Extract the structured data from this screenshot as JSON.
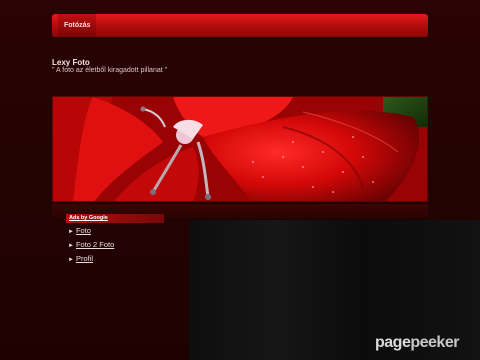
{
  "nav": {
    "tabs": [
      {
        "label": "Fotózás"
      }
    ]
  },
  "site": {
    "title": "Lexy Foto",
    "slogan": "\" A foto az életből kiragadott pillanat \""
  },
  "sidebar": {
    "ads_header": "Ads by Google",
    "links": [
      {
        "label": "Foto"
      },
      {
        "label": "Foto 2 Foto"
      },
      {
        "label": "Profil"
      }
    ]
  },
  "watermark": {
    "part1": "page",
    "part2": "peeker"
  },
  "colors": {
    "accent": "#d01414",
    "background": "#200202"
  }
}
